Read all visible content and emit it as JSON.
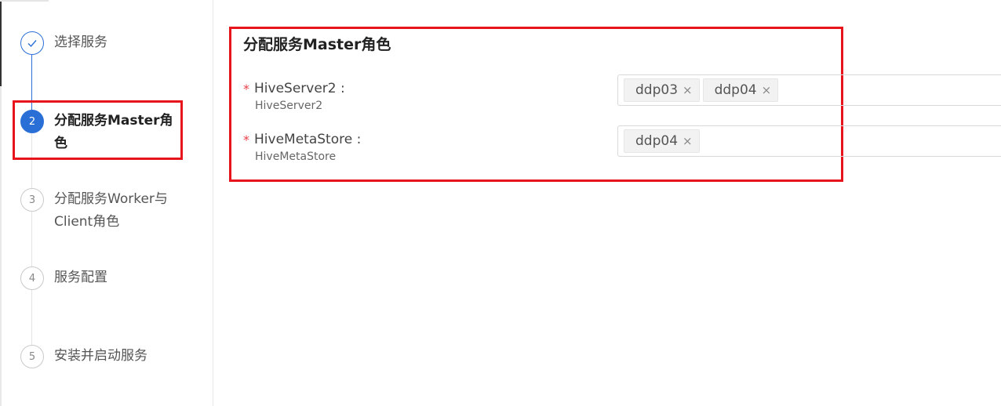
{
  "steps": [
    {
      "number": "1",
      "label": "选择服务",
      "status": "done"
    },
    {
      "number": "2",
      "label": "分配服务Master角色",
      "status": "active"
    },
    {
      "number": "3",
      "label": "分配服务Worker与Client角色",
      "status": "pending"
    },
    {
      "number": "4",
      "label": "服务配置",
      "status": "pending"
    },
    {
      "number": "5",
      "label": "安装并启动服务",
      "status": "pending"
    }
  ],
  "main": {
    "section_title": "分配服务Master角色",
    "fields": [
      {
        "required_mark": "*",
        "label": "HiveServer2 :",
        "sublabel": "HiveServer2",
        "tags": [
          {
            "text": "ddp03",
            "close": "×"
          },
          {
            "text": "ddp04",
            "close": "×"
          }
        ]
      },
      {
        "required_mark": "*",
        "label": "HiveMetaStore :",
        "sublabel": "HiveMetaStore",
        "tags": [
          {
            "text": "ddp04",
            "close": "×"
          }
        ]
      }
    ]
  },
  "colors": {
    "accent": "#2a6fd6",
    "highlight": "#e8141b",
    "required": "#e8414a"
  },
  "icons": {
    "step_done": "check-icon",
    "tag_remove": "close-icon"
  }
}
